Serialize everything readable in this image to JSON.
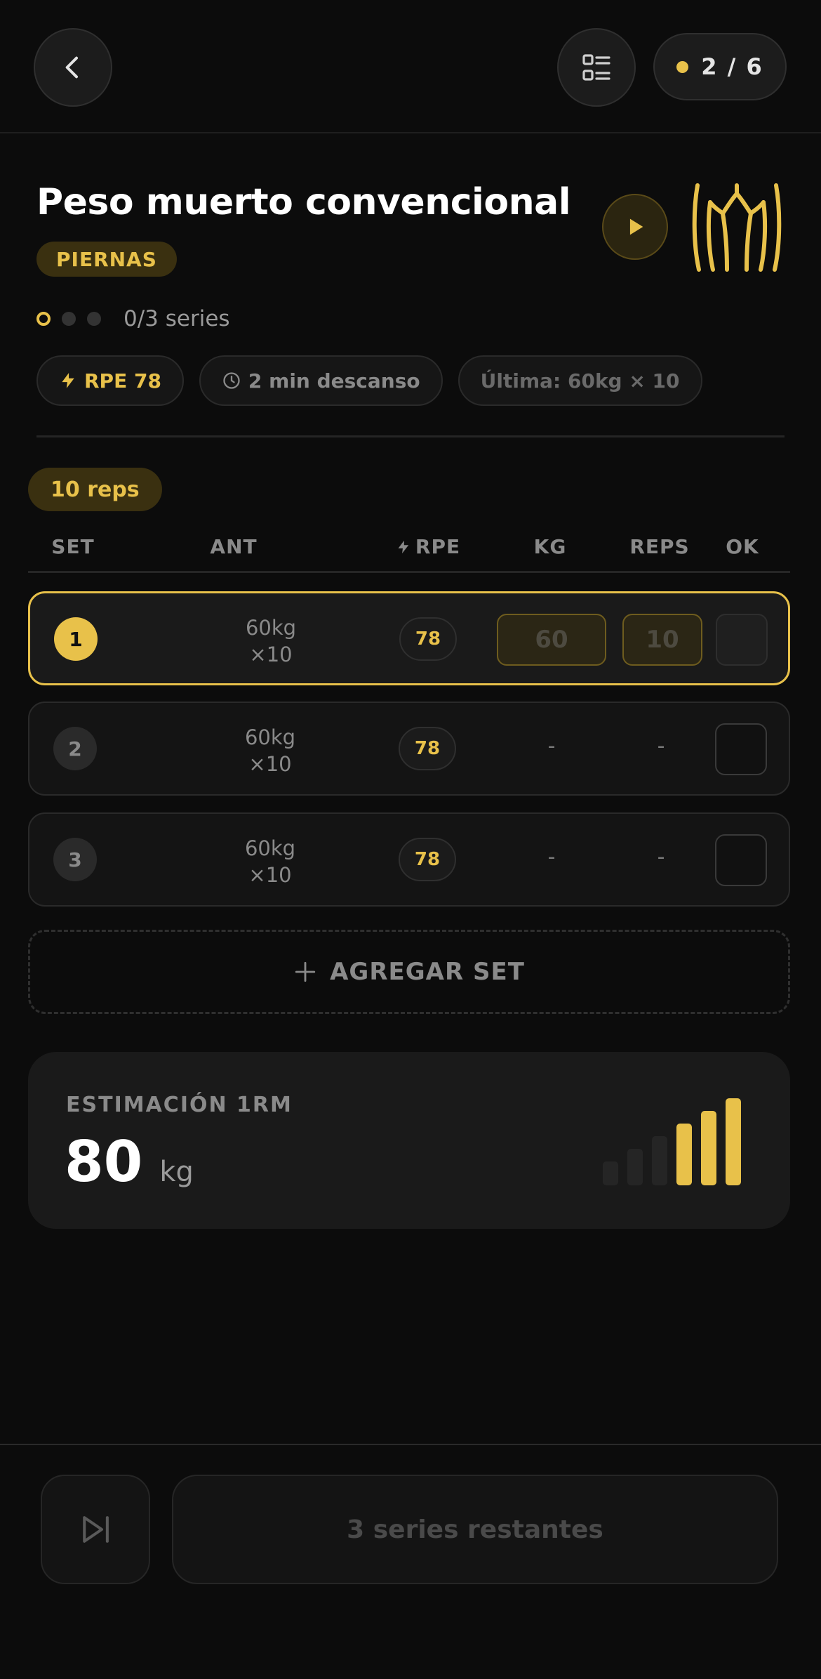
{
  "header": {
    "progress": "2 / 6"
  },
  "exercise": {
    "title": "Peso muerto convencional",
    "category": "PIERNAS",
    "series_progress": "0/3 series",
    "chips": {
      "rpe": "RPE 78",
      "rest": "2 min descanso",
      "last": "Última: 60kg × 10"
    }
  },
  "target_reps": "10 reps",
  "columns": {
    "set": "SET",
    "prev": "ANT",
    "rpe": "RPE",
    "kg": "KG",
    "reps": "REPS",
    "ok": "OK"
  },
  "sets": [
    {
      "num": "1",
      "prev_kg": "60kg",
      "prev_reps": "×10",
      "rpe": "78",
      "kg": "60",
      "reps": "10",
      "done": false
    },
    {
      "num": "2",
      "prev_kg": "60kg",
      "prev_reps": "×10",
      "rpe": "78",
      "kg": "-",
      "reps": "-",
      "done": false
    },
    {
      "num": "3",
      "prev_kg": "60kg",
      "prev_reps": "×10",
      "rpe": "78",
      "kg": "-",
      "reps": "-",
      "done": false
    }
  ],
  "add_set_label": "AGREGAR SET",
  "one_rm": {
    "label": "ESTIMACIÓN 1RM",
    "value": "80",
    "unit": "kg",
    "strength_level": 3,
    "strength_max": 6
  },
  "footer": {
    "remaining_label": "3 series restantes"
  },
  "colors": {
    "accent": "#e8c14a",
    "background": "#0c0c0c",
    "card": "#1a1a1a"
  },
  "icons": [
    "back-arrow-icon",
    "list-icon",
    "play-icon",
    "muscle-icon",
    "bolt-icon",
    "clock-icon",
    "plus-icon",
    "skip-next-icon"
  ]
}
